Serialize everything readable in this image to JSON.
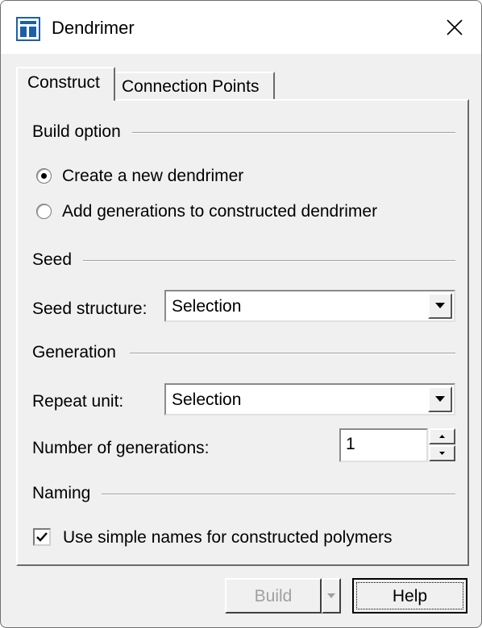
{
  "window": {
    "title": "Dendrimer",
    "icon": "app-icon",
    "close_icon": "close-icon"
  },
  "tabs": [
    {
      "label": "Construct",
      "active": true
    },
    {
      "label": "Connection Points",
      "active": false
    }
  ],
  "build_option": {
    "section_label": "Build option",
    "options": [
      {
        "label": "Create a new dendrimer",
        "checked": true
      },
      {
        "label": "Add generations to constructed dendrimer",
        "checked": false
      }
    ]
  },
  "seed": {
    "section_label": "Seed",
    "structure_label": "Seed structure:",
    "structure_value": "Selection"
  },
  "generation": {
    "section_label": "Generation",
    "repeat_unit_label": "Repeat unit:",
    "repeat_unit_value": "Selection",
    "num_generations_label": "Number of generations:",
    "num_generations_value": "1"
  },
  "naming": {
    "section_label": "Naming",
    "simple_names_label": "Use simple names for constructed polymers",
    "simple_names_checked": true
  },
  "buttons": {
    "build": "Build",
    "build_enabled": false,
    "help": "Help"
  },
  "colors": {
    "window_bg": "#f0f0f0",
    "titlebar_bg": "#ffffff",
    "icon_blue": "#1c5fa8",
    "disabled_text": "#a0a0a0"
  }
}
